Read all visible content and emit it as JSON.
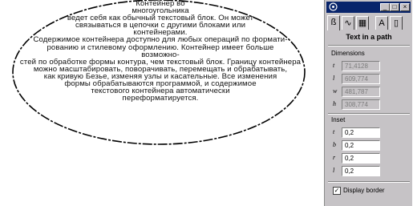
{
  "canvas": {
    "text_lines": [
      "Контейнер во",
      "многоугольника",
      "ведет себя как обычный текстовый блок. Он может",
      "связываться в цепочки с другими блоками или",
      "контейнерами.",
      "Содержимое контейнера доступно для любых операций по формати-",
      "рованию и стилевому оформлению. Контейнер имеет больше",
      "возможно-",
      "стей по обработке формы контура, чем текстовый блок. Границу контейнера",
      "можно масштабировать, поворачивать, перемещать и обрабатывать,",
      "как кривую Безье, изменяя узлы и касательные. Все изменения",
      "формы обрабатываются программой, и содержимое",
      "текстового контейнера автоматически",
      "переформатируется."
    ]
  },
  "palette": {
    "title_buttons": [
      "_",
      "□",
      "×"
    ],
    "tabs": [
      "text-path-tab",
      "curve-tab",
      "fill-tab",
      "type-tab",
      "page-tab"
    ],
    "tab_glyphs": [
      "ß",
      "∿",
      "▦",
      "A",
      "▯"
    ],
    "panel_title": "Text in a path",
    "dimensions_label": "Dimensions",
    "dimensions": [
      {
        "icon": "t",
        "value": "71,4128"
      },
      {
        "icon": "l",
        "value": "609,774"
      },
      {
        "icon": "w",
        "value": "481,787"
      },
      {
        "icon": "h",
        "value": "308,774"
      }
    ],
    "inset_label": "Inset",
    "inset": [
      {
        "icon": "t",
        "value": "0,2"
      },
      {
        "icon": "b",
        "value": "0,2"
      },
      {
        "icon": "r",
        "value": "0,2"
      },
      {
        "icon": "l",
        "value": "0,2"
      }
    ],
    "display_border_label": "Display border",
    "display_border_checked": "✓"
  }
}
